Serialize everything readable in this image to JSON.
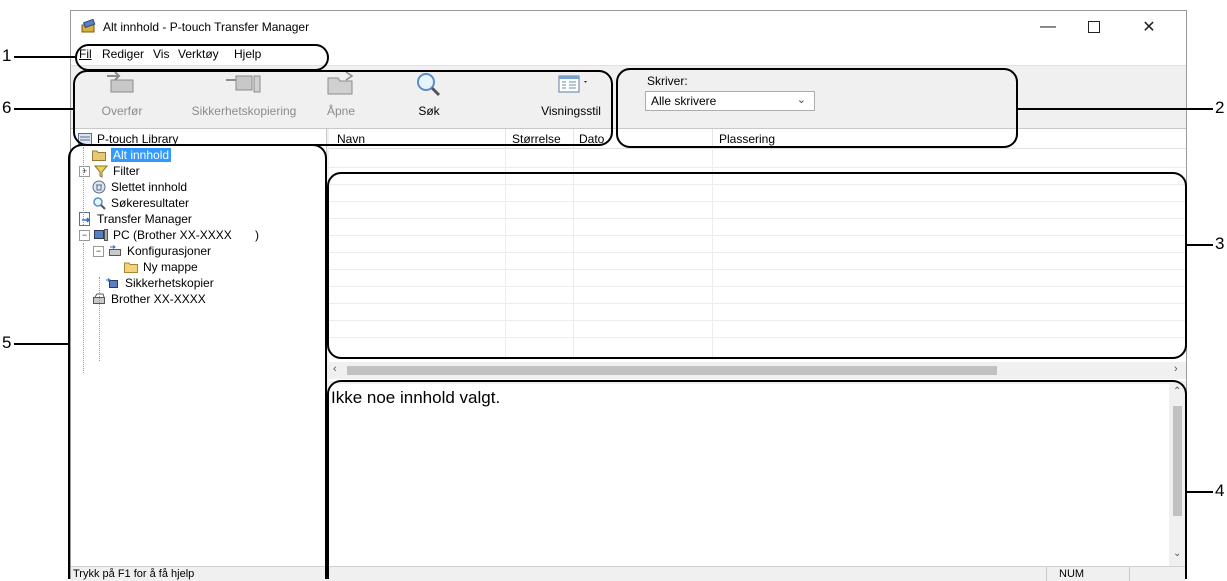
{
  "window": {
    "title": "Alt innhold - P-touch Transfer Manager",
    "controls": [
      "minimize-icon",
      "maximize-icon",
      "close-icon"
    ]
  },
  "menu": {
    "items": [
      {
        "label": "Fil",
        "underline": "F"
      },
      {
        "label": "Rediger",
        "underline": "R"
      },
      {
        "label": "Vis",
        "underline": "V"
      },
      {
        "label": "Verktøy",
        "underline": "e"
      },
      {
        "label": "Hjelp",
        "underline": "H"
      }
    ]
  },
  "toolbar": {
    "transfer": "Overfør",
    "backup": "Sikkerhetskopiering",
    "open": "Åpne",
    "search": "Søk",
    "view_style": "Visningsstil",
    "printer_label": "Skriver:",
    "printer_value": "Alle skrivere"
  },
  "tree": {
    "library": "P-touch Library",
    "all_content": "Alt innhold",
    "filter": "Filter",
    "deleted": "Slettet innhold",
    "search_results": "Søkeresultater",
    "transfer_manager": "Transfer Manager",
    "pc": "PC (Brother XX-XXXX       )",
    "configurations": "Konfigurasjoner",
    "new_folder": "Ny mappe",
    "backups": "Sikkerhetskopier",
    "brother": "Brother XX-XXXX"
  },
  "list": {
    "columns": [
      "Navn",
      "Størrelse",
      "Dato",
      "Plassering"
    ]
  },
  "preview": {
    "text": "Ikke noe innhold valgt."
  },
  "status": {
    "help": "Trykk på F1 for å få hjelp",
    "num": "NUM"
  },
  "callouts": {
    "labels": [
      "1",
      "2",
      "3",
      "4",
      "5",
      "6"
    ]
  }
}
